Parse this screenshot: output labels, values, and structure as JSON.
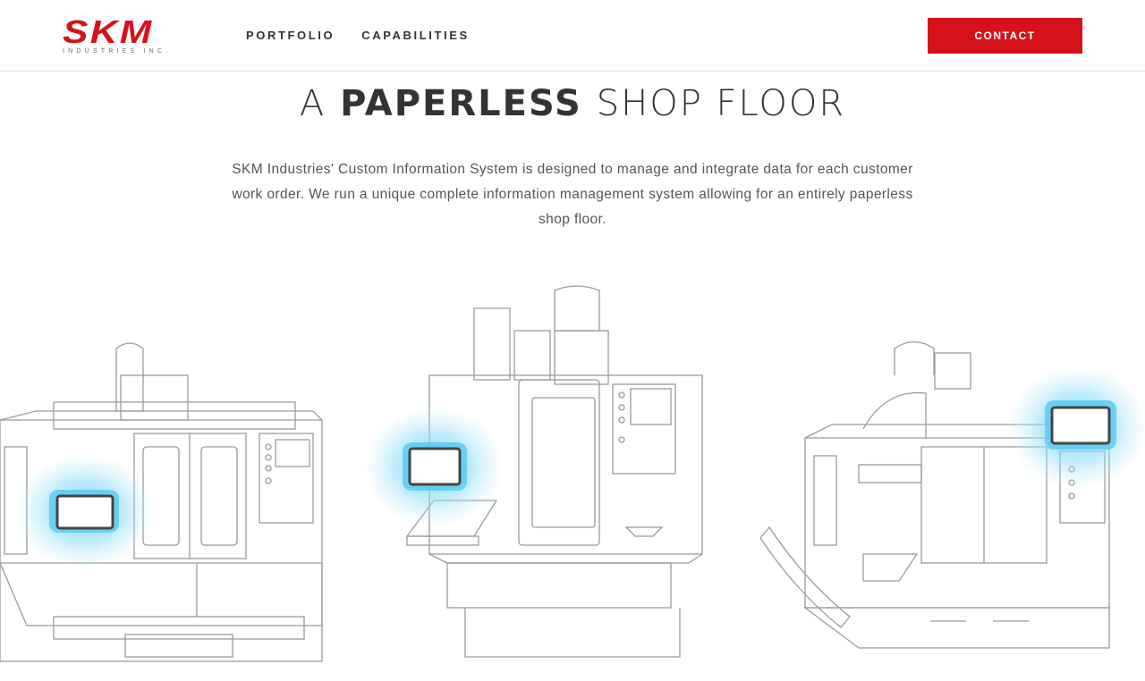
{
  "brand": {
    "logo_text": "SKM",
    "logo_subtitle": "INDUSTRIES INC.",
    "accent_color": "#d5121b"
  },
  "nav": {
    "items": [
      {
        "label": "PORTFOLIO"
      },
      {
        "label": "CAPABILITIES"
      }
    ],
    "contact_label": "CONTACT"
  },
  "hero": {
    "title_prefix": "A",
    "title_bold": "PAPERLESS",
    "title_suffix": "SHOP FLOOR",
    "description": "SKM Industries' Custom Information System is designed to manage and integrate data for each customer work order. We run a unique complete information management system allowing for an entirely paperless shop floor."
  },
  "illustration": {
    "subject": "cnc-machines-with-tablets",
    "highlight_color": "#7fd6f2"
  }
}
